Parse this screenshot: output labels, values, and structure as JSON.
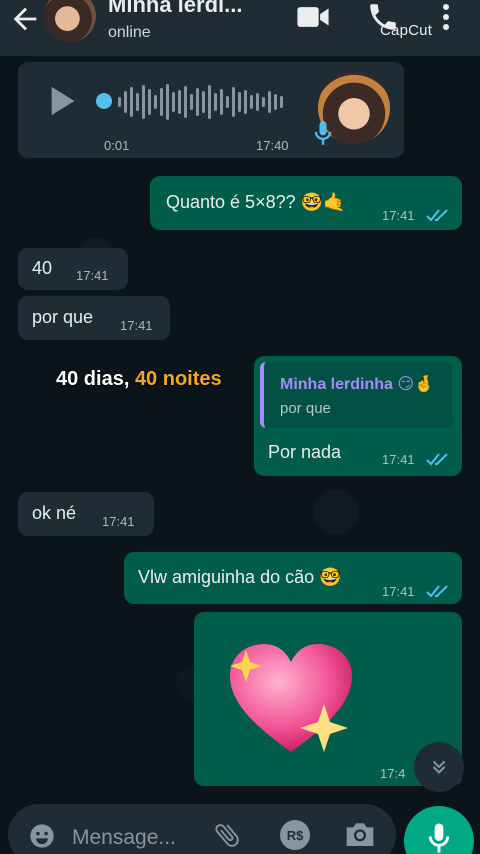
{
  "header": {
    "contact_name": "Minha lerdi...",
    "status": "online",
    "watermark": "CapCut",
    "icons": [
      "back-arrow-icon",
      "video-call-icon",
      "phone-call-icon",
      "more-vert-icon"
    ]
  },
  "audio_message": {
    "duration": "0:01",
    "time": "17:40"
  },
  "messages": [
    {
      "dir": "out",
      "text": "Quanto é 5×8?? 🤓🤙",
      "time": "17:41",
      "ticks": "read"
    },
    {
      "dir": "in",
      "text": "40",
      "time": "17:41"
    },
    {
      "dir": "in",
      "text": "por que",
      "time": "17:41"
    },
    {
      "dir": "out",
      "reply_to_name": "Minha lerdinha 😏🤞",
      "reply_to_text": "por que",
      "text": "Por nada",
      "time": "17:41",
      "ticks": "read"
    },
    {
      "dir": "in",
      "text": "ok né",
      "time": "17:41"
    },
    {
      "dir": "out",
      "text": "Vlw amiguinha do cão 🤓",
      "time": "17:41",
      "ticks": "read"
    },
    {
      "dir": "out",
      "sticker": "sparkling-heart",
      "time": "17:4"
    }
  ],
  "overlay": {
    "part1": "40 dias, ",
    "part2": "40 noites"
  },
  "composer": {
    "placeholder": "Mensage...",
    "rs_label": "R$"
  },
  "colors": {
    "incoming_bubble": "#202c33",
    "outgoing_bubble": "#005c4b",
    "accent_green": "#00a884",
    "read_ticks": "#53bdeb",
    "quote_name": "#a78bfa"
  }
}
